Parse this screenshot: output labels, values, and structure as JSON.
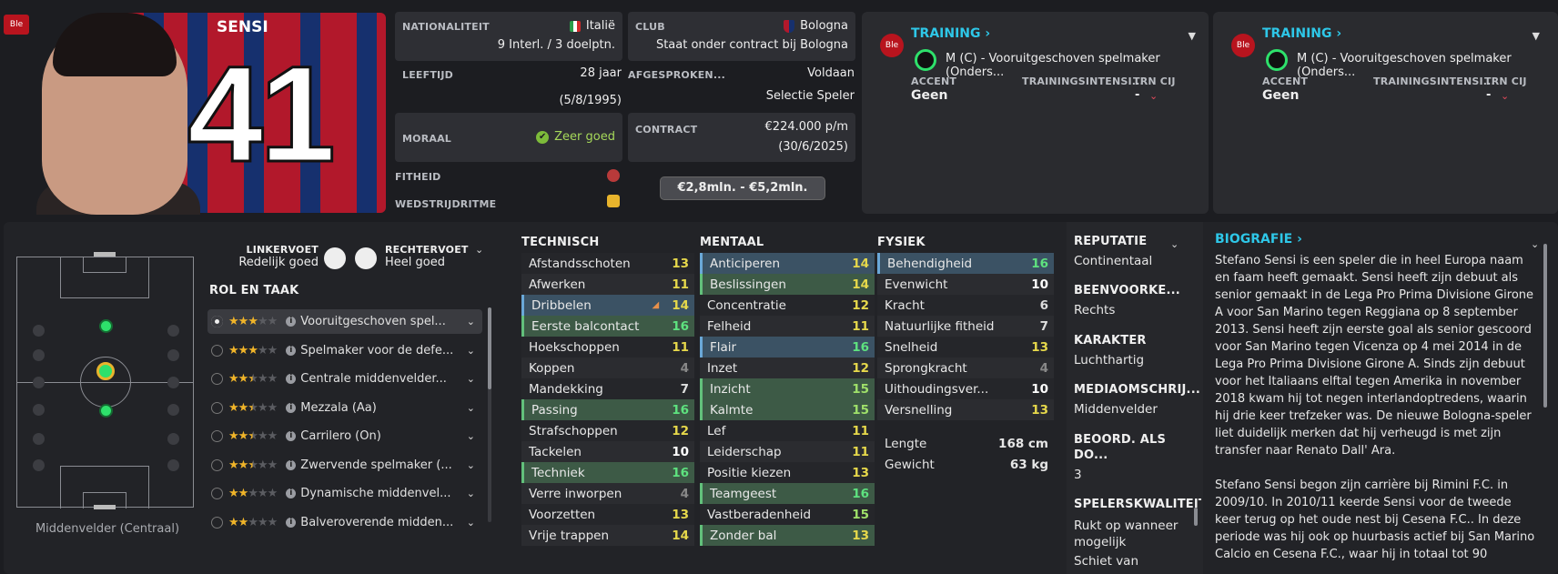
{
  "header": {
    "club_badge": "Ble",
    "player_name": "SENSI",
    "shirt_number": "41"
  },
  "details": {
    "nationality_label": "NATIONALITEIT",
    "nationality": "Italië",
    "caps": "9 Interl. / 3 doelptn.",
    "club_label": "CLUB",
    "club": "Bologna",
    "club_status": "Staat onder contract bij Bologna",
    "age_label": "LEEFTIJD",
    "age": "28 jaar",
    "dob": "(5/8/1995)",
    "agreed_label": "AFGESPROKEN...",
    "agreed_value": "Voldaan",
    "agreed_sub": "Selectie Speler",
    "morale_label": "MORAAL",
    "morale": "Zeer goed",
    "contract_label": "CONTRACT",
    "wage": "€224.000 p/m",
    "contract_end": "(30/6/2025)",
    "fitness_label": "FITHEID",
    "match_rhythm_label": "WEDSTRIJDRITME",
    "value_range": "€2,8mln. - €5,2mln."
  },
  "training_cards": [
    {
      "title": "TRAINING ›",
      "badge": "Ble",
      "role": "M (C) - Vooruitgeschoven spelmaker (Onders...",
      "accent_label": "ACCENT",
      "accent": "Geen",
      "intensity_label": "TRAININGSINTENSI...",
      "intensity": "-",
      "trn_label": "TRN CIJ"
    },
    {
      "title": "TRAINING ›",
      "badge": "Ble",
      "role": "M (C) - Vooruitgeschoven spelmaker (Onders...",
      "accent_label": "ACCENT",
      "accent": "Geen",
      "intensity_label": "TRAININGSINTENSI...",
      "intensity": "-",
      "trn_label": "TRN CIJ"
    }
  ],
  "feet": {
    "left_label": "LINKERVOET",
    "left_value": "Redelijk goed",
    "right_label": "RECHTERVOET",
    "right_value": "Heel goed"
  },
  "pitch": {
    "position_label": "Middenvelder (Centraal)"
  },
  "roles": {
    "title": "ROL EN TAAK",
    "items": [
      {
        "name": "Vooruitgeschoven spel...",
        "stars": 3,
        "half": false
      },
      {
        "name": "Spelmaker voor de defe...",
        "stars": 3,
        "half": false
      },
      {
        "name": "Centrale middenvelder...",
        "stars": 2,
        "half": true
      },
      {
        "name": "Mezzala (Aa)",
        "stars": 2,
        "half": true
      },
      {
        "name": "Carrilero (On)",
        "stars": 2,
        "half": true
      },
      {
        "name": "Zwervende spelmaker (...",
        "stars": 2,
        "half": true
      },
      {
        "name": "Dynamische middenvel...",
        "stars": 2,
        "half": false
      },
      {
        "name": "Balveroverende midden...",
        "stars": 2,
        "half": false
      }
    ]
  },
  "technical": {
    "title": "TECHNISCH",
    "attrs": [
      {
        "name": "Afstandsschoten",
        "value": 13,
        "hl": ""
      },
      {
        "name": "Afwerken",
        "value": 11,
        "hl": ""
      },
      {
        "name": "Dribbelen",
        "value": 14,
        "hl": "b"
      },
      {
        "name": "Eerste balcontact",
        "value": 16,
        "hl": "g"
      },
      {
        "name": "Hoekschoppen",
        "value": 11,
        "hl": ""
      },
      {
        "name": "Koppen",
        "value": 4,
        "hl": ""
      },
      {
        "name": "Mandekking",
        "value": 7,
        "hl": ""
      },
      {
        "name": "Passing",
        "value": 16,
        "hl": "g"
      },
      {
        "name": "Strafschoppen",
        "value": 12,
        "hl": ""
      },
      {
        "name": "Tackelen",
        "value": 10,
        "hl": ""
      },
      {
        "name": "Techniek",
        "value": 16,
        "hl": "g"
      },
      {
        "name": "Verre inworpen",
        "value": 4,
        "hl": ""
      },
      {
        "name": "Voorzetten",
        "value": 13,
        "hl": ""
      },
      {
        "name": "Vrije trappen",
        "value": 14,
        "hl": ""
      }
    ]
  },
  "mental": {
    "title": "MENTAAL",
    "attrs": [
      {
        "name": "Anticiperen",
        "value": 14,
        "hl": "b"
      },
      {
        "name": "Beslissingen",
        "value": 14,
        "hl": "g"
      },
      {
        "name": "Concentratie",
        "value": 12,
        "hl": ""
      },
      {
        "name": "Felheid",
        "value": 11,
        "hl": ""
      },
      {
        "name": "Flair",
        "value": 16,
        "hl": "b"
      },
      {
        "name": "Inzet",
        "value": 12,
        "hl": ""
      },
      {
        "name": "Inzicht",
        "value": 15,
        "hl": "g"
      },
      {
        "name": "Kalmte",
        "value": 15,
        "hl": "g"
      },
      {
        "name": "Lef",
        "value": 11,
        "hl": ""
      },
      {
        "name": "Leiderschap",
        "value": 11,
        "hl": ""
      },
      {
        "name": "Positie kiezen",
        "value": 13,
        "hl": ""
      },
      {
        "name": "Teamgeest",
        "value": 16,
        "hl": "g"
      },
      {
        "name": "Vastberadenheid",
        "value": 15,
        "hl": ""
      },
      {
        "name": "Zonder bal",
        "value": 13,
        "hl": "g"
      }
    ]
  },
  "physical": {
    "title": "FYSIEK",
    "attrs": [
      {
        "name": "Behendigheid",
        "value": 16,
        "hl": "b"
      },
      {
        "name": "Evenwicht",
        "value": 10,
        "hl": ""
      },
      {
        "name": "Kracht",
        "value": 6,
        "hl": ""
      },
      {
        "name": "Natuurlijke fitheid",
        "value": 7,
        "hl": ""
      },
      {
        "name": "Snelheid",
        "value": 13,
        "hl": ""
      },
      {
        "name": "Sprongkracht",
        "value": 4,
        "hl": ""
      },
      {
        "name": "Uithoudingsver...",
        "value": 10,
        "hl": ""
      },
      {
        "name": "Versnelling",
        "value": 13,
        "hl": ""
      }
    ],
    "height_label": "Lengte",
    "height": "168 cm",
    "weight_label": "Gewicht",
    "weight": "63 kg"
  },
  "profile": {
    "reputation_label": "REPUTATIE",
    "reputation": "Continentaal",
    "preferred_label": "BEENVOORKE...",
    "preferred": "Rechts",
    "character_label": "KARAKTER",
    "character": "Luchthartig",
    "media_label": "MEDIAOMSCHRIJ...",
    "media": "Middenvelder",
    "rating_label": "BEOORD. ALS DO...",
    "rating": "3",
    "traits_label": "SPELERSKWALITEIT",
    "trait1": "Rukt op wanneer",
    "trait1b": "mogelijk",
    "trait2": "Schiet van"
  },
  "bio": {
    "title": "BIOGRAFIE ›",
    "p1": "Stefano Sensi is een speler die in heel Europa naam en faam heeft gemaakt. Sensi heeft zijn debuut als senior gemaakt in de Lega Pro Prima Divisione Girone A voor San Marino tegen Reggiana op 8 september 2013. Sensi heeft zijn eerste goal als senior gescoord voor San Marino tegen Vicenza op 4 mei 2014 in de Lega Pro Prima Divisione Girone A. Sinds zijn debuut voor het Italiaans elftal tegen Amerika in november 2018 kwam hij tot negen interlandoptredens, waarin hij drie keer trefzeker was. De nieuwe Bologna-speler liet duidelijk merken dat hij verheugd is met zijn transfer naar Renato Dall' Ara.",
    "p2": "Stefano Sensi begon zijn carrière bij Rimini F.C. in 2009/10. In 2010/11 keerde Sensi voor de tweede keer terug op het oude nest bij Cesena F.C.. In deze periode was hij ook op huurbasis actief bij San Marino Calcio en Cesena F.C., waar hij in totaal tot 90"
  }
}
